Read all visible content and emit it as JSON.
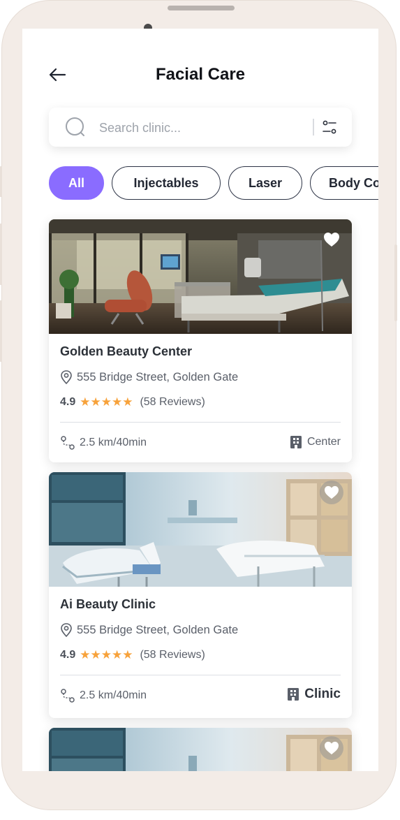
{
  "header": {
    "title": "Facial Care"
  },
  "search": {
    "placeholder": "Search clinic..."
  },
  "categories": [
    {
      "label": "All",
      "active": true
    },
    {
      "label": "Injectables",
      "active": false
    },
    {
      "label": "Laser",
      "active": false
    },
    {
      "label": "Body Co",
      "active": false
    }
  ],
  "clinics": [
    {
      "name": "Golden Beauty Center",
      "address": "555 Bridge Street, Golden Gate",
      "rating": "4.9",
      "stars": "★★★★★",
      "reviews": "(58 Reviews)",
      "distance": "2.5 km/40min",
      "type": "Center",
      "favorite_icon": "heart-icon"
    },
    {
      "name": "Ai Beauty Clinic",
      "address": "555 Bridge Street, Golden Gate",
      "rating": "4.9",
      "stars": "★★★★★",
      "reviews": "(58 Reviews)",
      "distance": "2.5 km/40min",
      "type": "Clinic",
      "favorite_icon": "heart-icon"
    }
  ],
  "colors": {
    "accent": "#8a6cff",
    "star": "#f7a23b",
    "phone_frame": "#f3ece7"
  }
}
